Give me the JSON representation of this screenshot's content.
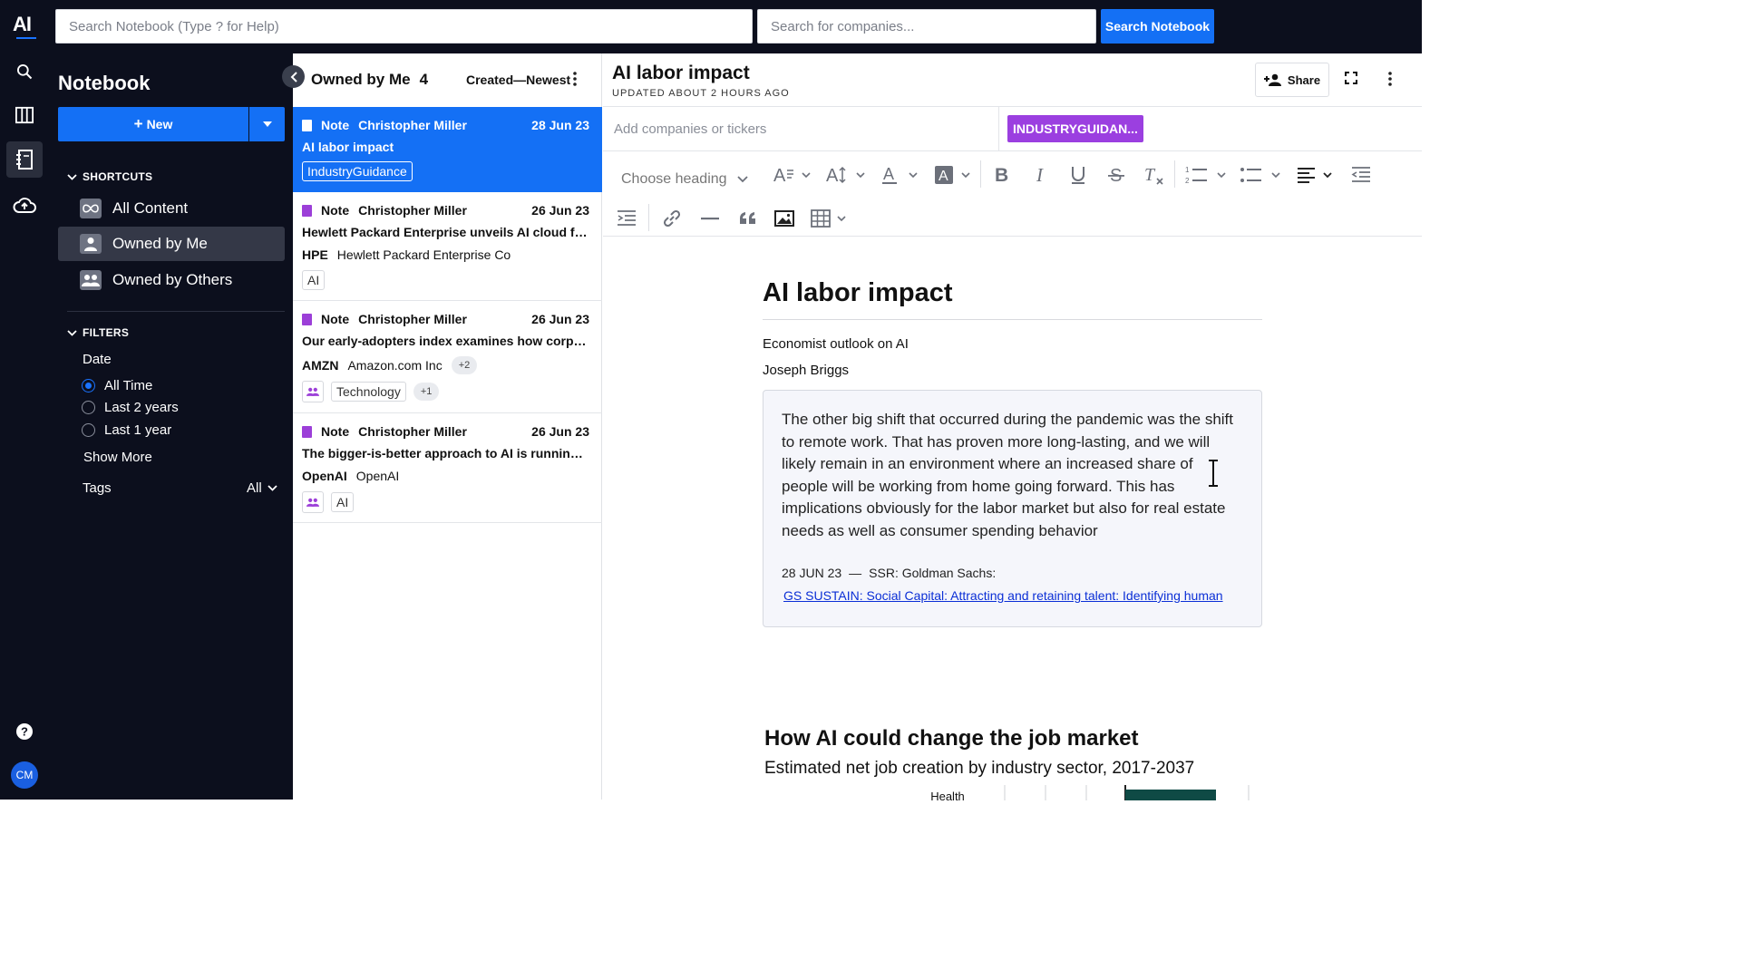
{
  "topbar": {
    "brand": "AI",
    "notebook_search_placeholder": "Search Notebook (Type ? for Help)",
    "company_search_placeholder": "Search for companies...",
    "search_button": "Search Notebook"
  },
  "rail": {
    "icons": [
      "search-icon",
      "columns-icon",
      "notebook-icon",
      "cloud-upload-icon",
      "help-icon"
    ],
    "avatar": "CM"
  },
  "sidebar": {
    "title": "Notebook",
    "new_button": "New",
    "shortcuts_label": "SHORTCUTS",
    "shortcuts": [
      {
        "label": "All Content",
        "icon": "infinity-icon"
      },
      {
        "label": "Owned by Me",
        "icon": "person-icon",
        "active": true
      },
      {
        "label": "Owned by Others",
        "icon": "group-icon"
      }
    ],
    "filters_label": "FILTERS",
    "date_label": "Date",
    "date_options": [
      {
        "label": "All Time",
        "selected": true
      },
      {
        "label": "Last 2 years",
        "selected": false
      },
      {
        "label": "Last 1 year",
        "selected": false
      }
    ],
    "show_more": "Show More",
    "tags_label": "Tags",
    "tags_value": "All"
  },
  "list": {
    "heading": "Owned by Me",
    "count": "4",
    "sort": "Created—Newest",
    "notes": [
      {
        "type": "Note",
        "author": "Christopher Miller",
        "date": "28 Jun 23",
        "title": "AI labor impact",
        "tags": [
          "IndustryGuidance"
        ]
      },
      {
        "type": "Note",
        "author": "Christopher Miller",
        "date": "26 Jun 23",
        "title": "Hewlett Packard Enterprise unveils AI cloud fo...",
        "ticker": "HPE",
        "company": "Hewlett Packard Enterprise Co",
        "tags": [
          "AI"
        ]
      },
      {
        "type": "Note",
        "author": "Christopher Miller",
        "date": "26 Jun 23",
        "title": "Our early-adopters index examines how corpo...",
        "ticker": "AMZN",
        "company": "Amazon.com Inc",
        "company_more": "+2",
        "tags": [
          "Technology"
        ],
        "tags_more": "+1"
      },
      {
        "type": "Note",
        "author": "Christopher Miller",
        "date": "26 Jun 23",
        "title": "The bigger-is-better approach to AI is running ...",
        "ticker": "OpenAI",
        "company": "OpenAI",
        "tags": [
          "AI"
        ]
      }
    ]
  },
  "editor": {
    "title": "AI labor impact",
    "updated": "UPDATED ABOUT 2 HOURS AGO",
    "share": "Share",
    "tickers_placeholder": "Add companies or tickers",
    "tag_badge": "INDUSTRYGUIDAN...",
    "heading_select": "Choose heading",
    "doc": {
      "h1": "AI labor impact",
      "line1": "Economist outlook on AI",
      "line2": "Joseph Briggs",
      "quote": "The other big shift that occurred during the pandemic was the shift to remote work. That has proven more long-lasting, and we will likely remain in an environment where an increased share of people will be working from home going forward. This has implications obviously for the labor market but also for real estate needs as well as consumer spending behavior",
      "quote_date": "28 JUN 23",
      "quote_dash": "—",
      "quote_source": "SSR: Goldman Sachs:",
      "quote_link": "GS SUSTAIN: Social Capital: Attracting and retaining talent: Identifying human",
      "chart_title": "How AI could change the job market",
      "chart_subtitle": "Estimated net job creation by industry sector, 2017-2037",
      "chart_peek_label": "Health"
    }
  }
}
